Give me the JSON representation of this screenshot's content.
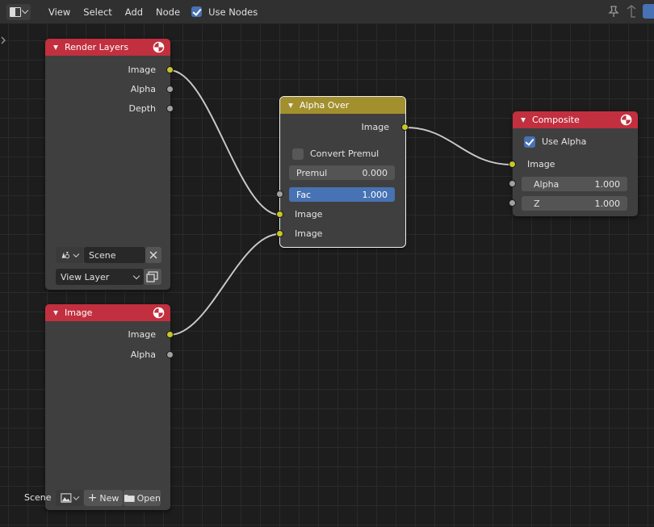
{
  "header": {
    "menu": [
      "View",
      "Select",
      "Add",
      "Node"
    ],
    "use_nodes_label": "Use Nodes",
    "use_nodes_checked": true,
    "accent_color": "#4772b3"
  },
  "nodes": {
    "render_layers": {
      "title": "Render Layers",
      "outputs": [
        "Image",
        "Alpha",
        "Depth"
      ],
      "scene_value": "Scene",
      "view_layer_value": "View Layer"
    },
    "image": {
      "title": "Image",
      "outputs": [
        "Image",
        "Alpha"
      ],
      "scene_label": "Scene",
      "new_label": "New",
      "open_label": "Open"
    },
    "alpha_over": {
      "title": "Alpha Over",
      "output": "Image",
      "convert_premul_label": "Convert Premul",
      "convert_premul_checked": false,
      "premul": {
        "label": "Premul",
        "value": "0.000"
      },
      "fac": {
        "label": "Fac",
        "value": "1.000"
      },
      "inputs": [
        "Image",
        "Image"
      ]
    },
    "composite": {
      "title": "Composite",
      "use_alpha_label": "Use Alpha",
      "use_alpha_checked": true,
      "input_image": "Image",
      "alpha": {
        "label": "Alpha",
        "value": "1.000"
      },
      "z": {
        "label": "Z",
        "value": "1.000"
      }
    }
  },
  "colors": {
    "node_header_red": "#c22f3e",
    "node_header_yellow": "#a28f2e",
    "socket_color": "#c7c729",
    "socket_value": "#a1a1a1"
  }
}
